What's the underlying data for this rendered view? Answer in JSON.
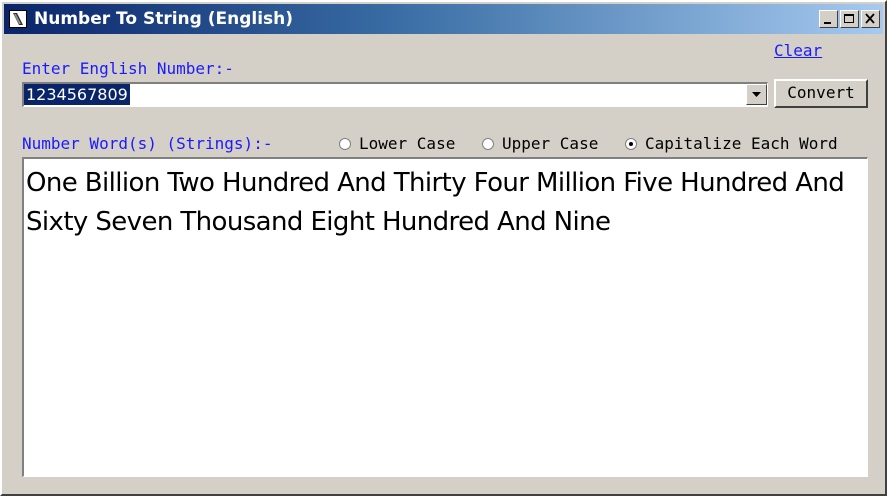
{
  "window": {
    "title": "Number To String (English)",
    "icon": "app-icon"
  },
  "colors": {
    "label": "#1a1aff",
    "titlebar_start": "#0a246a",
    "titlebar_end": "#a6caf0",
    "face": "#d4d0c8"
  },
  "input": {
    "label": "Enter English Number:-",
    "value": "1234567809"
  },
  "actions": {
    "clear_label": "Clear",
    "convert_label": "Convert"
  },
  "output": {
    "label": "Number Word(s) (Strings):-",
    "text": "One Billion Two Hundred And Thirty Four Million Five Hundred And Sixty Seven Thousand Eight Hundred And Nine"
  },
  "case_options": {
    "lower": "Lower Case",
    "upper": "Upper Case",
    "capitalize": "Capitalize Each Word",
    "selected": "capitalize"
  }
}
